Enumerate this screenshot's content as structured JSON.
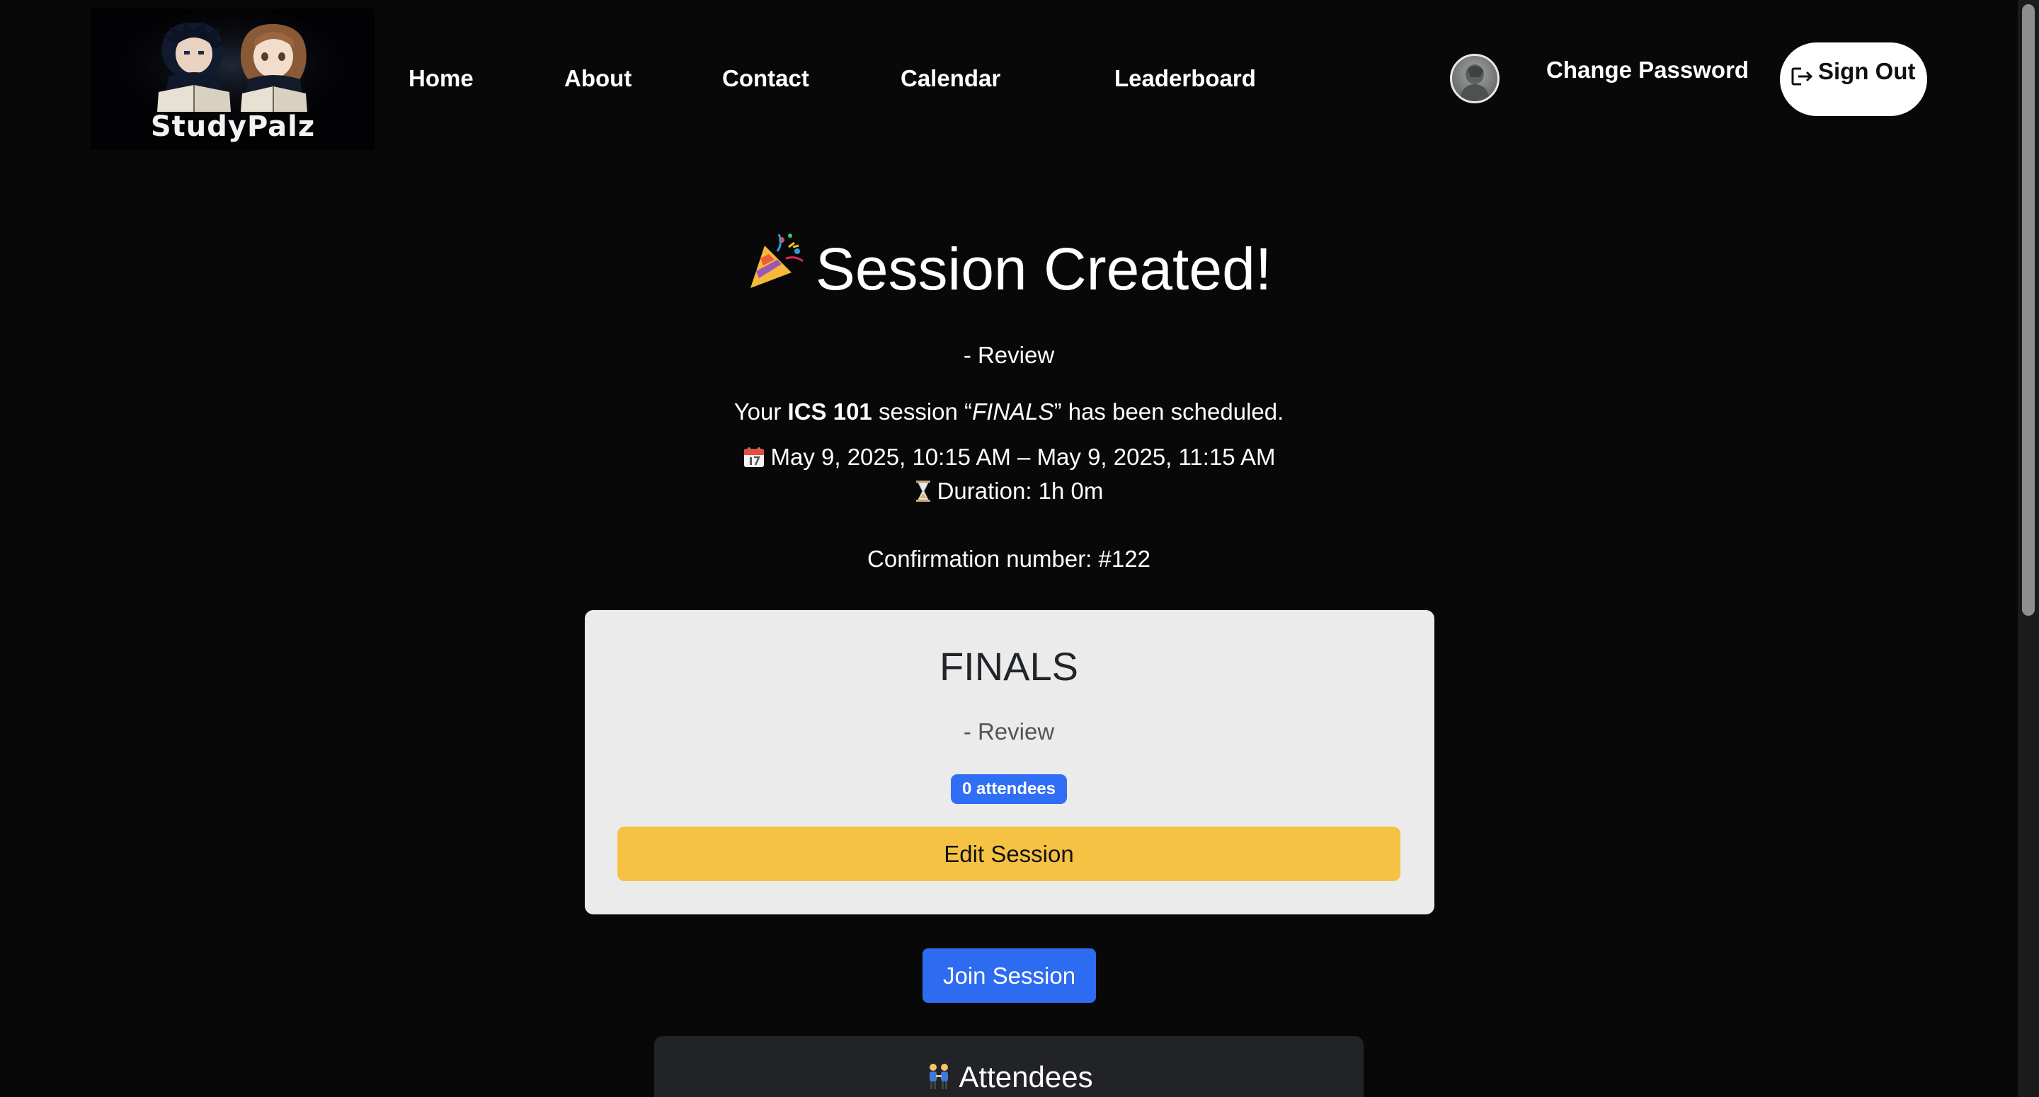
{
  "brand": {
    "logo_text": "StudyPalz"
  },
  "nav": {
    "home": "Home",
    "about": "About",
    "contact": "Contact",
    "calendar": "Calendar",
    "leaderboard": "Leaderboard",
    "change_password": "Change Password",
    "sign_out": "Sign Out"
  },
  "confirmation": {
    "headline": "Session Created!",
    "subtitle": "- Review",
    "sched_prefix": "Your ",
    "course": "ICS 101",
    "sched_mid": " session “",
    "session_name": "FINALS",
    "sched_suffix": "” has been scheduled.",
    "date_range": "May 9, 2025, 10:15 AM – May 9, 2025, 11:15 AM",
    "duration": "Duration: 1h 0m",
    "confirmation_number": "Confirmation number: #122"
  },
  "card": {
    "title": "FINALS",
    "subtitle": "- Review",
    "attendees_badge": "0 attendees",
    "edit_label": "Edit Session"
  },
  "join_label": "Join Session",
  "attendees": {
    "title": "Attendees"
  },
  "colors": {
    "background": "#080808",
    "card": "#ebebeb",
    "edit_button": "#f5c244",
    "join_button": "#2d6cf0",
    "badge": "#2f6ef5"
  },
  "icons": {
    "headline": "party-popper-icon",
    "date": "calendar-icon",
    "duration": "hourglass-icon",
    "attendees": "people-holding-hands-icon",
    "sign_out": "sign-out-icon"
  }
}
